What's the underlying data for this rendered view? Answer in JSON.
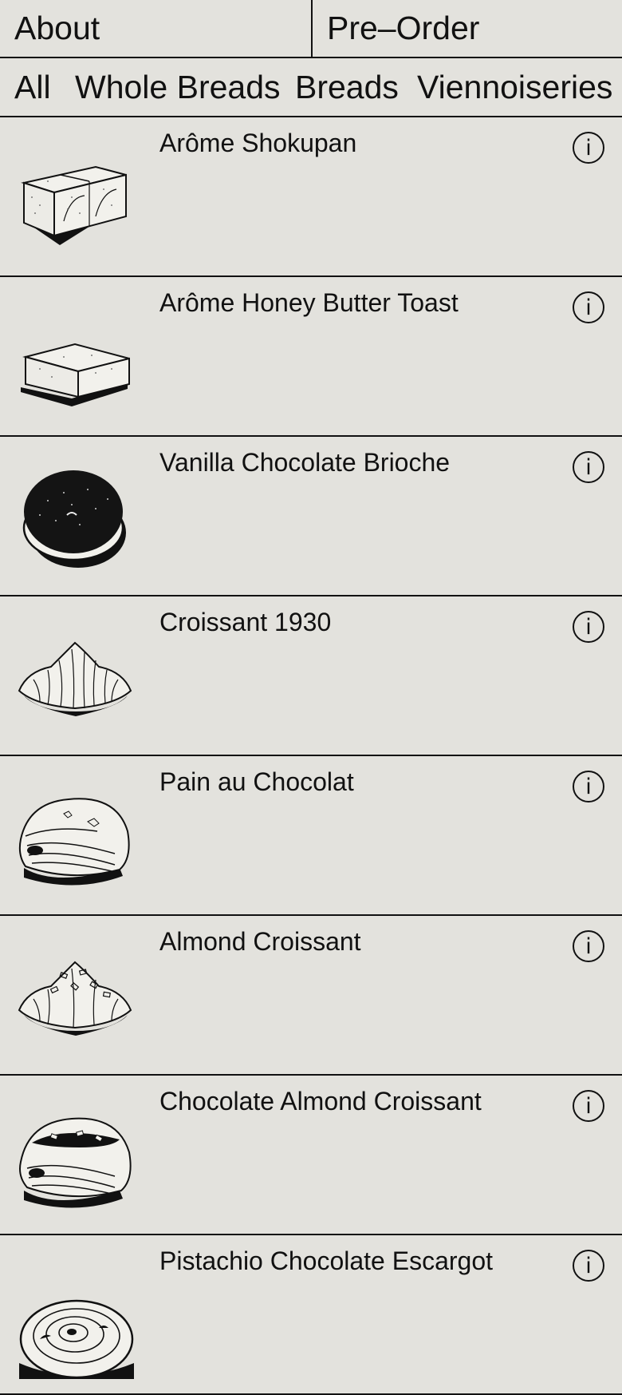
{
  "nav": {
    "about_label": "About",
    "preorder_label": "Pre–Order"
  },
  "filters": [
    {
      "label": "All"
    },
    {
      "label": "Whole Breads"
    },
    {
      "label": "Breads"
    },
    {
      "label": "Viennoiseries"
    }
  ],
  "products": [
    {
      "name": "Arôme Shokupan",
      "illustration": "shokupan-loaf-icon",
      "info_glyph": "i"
    },
    {
      "name": "Arôme Honey Butter Toast",
      "illustration": "butter-toast-icon",
      "info_glyph": "i"
    },
    {
      "name": "Vanilla Chocolate Brioche",
      "illustration": "chocolate-brioche-icon",
      "info_glyph": "i"
    },
    {
      "name": "Croissant 1930",
      "illustration": "croissant-icon",
      "info_glyph": "i"
    },
    {
      "name": "Pain au Chocolat",
      "illustration": "pain-au-chocolat-icon",
      "info_glyph": "i"
    },
    {
      "name": "Almond Croissant",
      "illustration": "almond-croissant-icon",
      "info_glyph": "i"
    },
    {
      "name": "Chocolate Almond Croissant",
      "illustration": "chocolate-almond-croissant-icon",
      "info_glyph": "i"
    },
    {
      "name": "Pistachio Chocolate Escargot",
      "illustration": "escargot-pastry-icon",
      "info_glyph": "i"
    }
  ],
  "colors": {
    "background": "#e3e2dd",
    "ink": "#111111"
  }
}
